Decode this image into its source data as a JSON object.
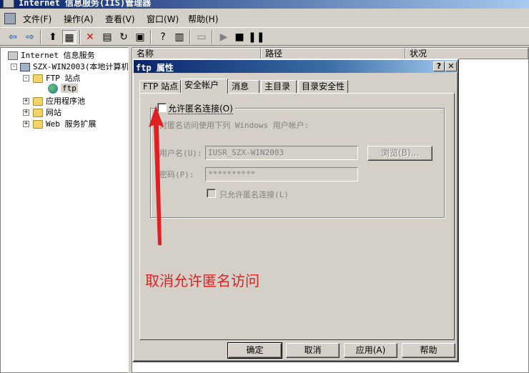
{
  "window": {
    "title": "Internet 信息服务(IIS)管理器"
  },
  "menubar": [
    "文件(F)",
    "操作(A)",
    "查看(V)",
    "窗口(W)",
    "帮助(H)"
  ],
  "tree": {
    "root": "Internet 信息服务",
    "server": "SZX-WIN2003(本地计算机)",
    "ftp_sites": "FTP 站点",
    "ftp_node": "ftp",
    "app_pools": "应用程序池",
    "websites": "网站",
    "web_ext": "Web 服务扩展"
  },
  "list_headers": [
    "名称",
    "路径",
    "状况"
  ],
  "dialog": {
    "title": "ftp 属性",
    "tabs": [
      "FTP 站点",
      "安全帐户",
      "消息",
      "主目录",
      "目录安全性"
    ],
    "active_tab": "安全帐户",
    "allow_anonymous_label": "允许匿名连接(O)",
    "allow_anonymous_checked": false,
    "desc": "对匿名访问使用下列 Windows 用户帐户:",
    "username_label": "用户名(U):",
    "username_value": "IUSR_SZX-WIN2003",
    "browse_label": "浏览(B)...",
    "password_label": "密码(P):",
    "password_value": "**********",
    "only_anon_label": "只允许匿名连接(L)",
    "buttons": {
      "ok": "确定",
      "cancel": "取消",
      "apply": "应用(A)",
      "help": "帮助"
    }
  },
  "annotation": "取消允许匿名访问",
  "colors": {
    "annotation": "#e02020",
    "title_bar": "#0a246a"
  }
}
